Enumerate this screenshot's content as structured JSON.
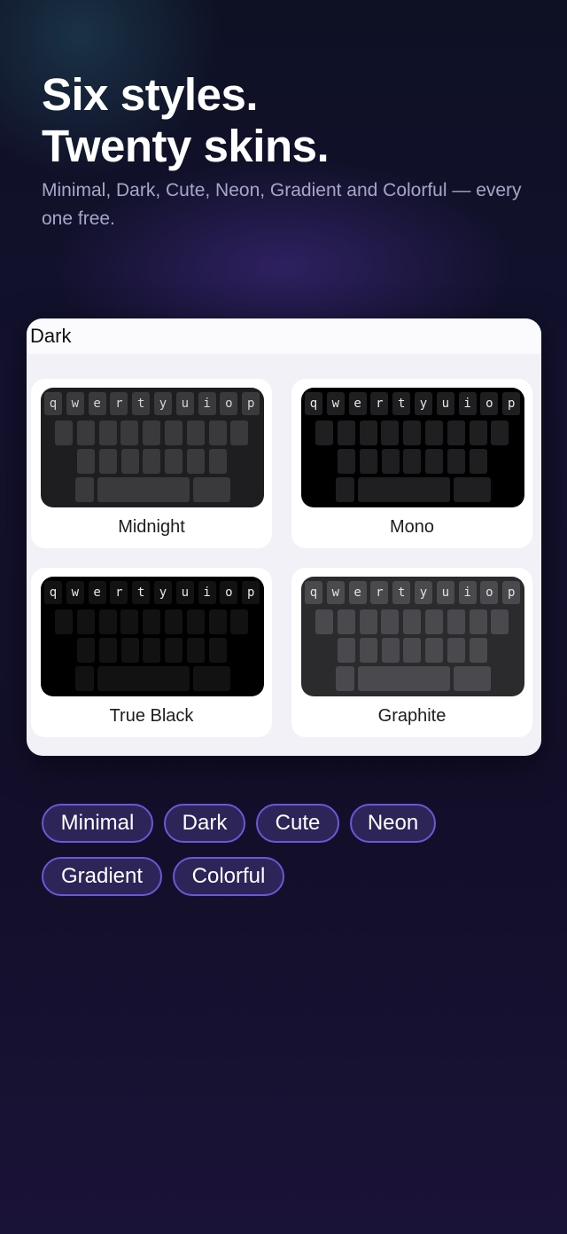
{
  "hero": {
    "title_line1": "Six styles.",
    "title_line2": "Twenty skins.",
    "subtitle": "Minimal, Dark, Cute, Neon, Gradient and Colorful — every one free."
  },
  "panel": {
    "header": "Dark",
    "skins": [
      {
        "name": "Midnight",
        "bg": "#1e1e20",
        "key": "#3a3a3d",
        "text": "#d6d6d8"
      },
      {
        "name": "Mono",
        "bg": "#000000",
        "key": "#1f1f21",
        "text": "#e8e8e8"
      },
      {
        "name": "True Black",
        "bg": "#000000",
        "key": "#121213",
        "text": "#e8e8e8"
      },
      {
        "name": "Graphite",
        "bg": "#2b2b2e",
        "key": "#4a4a4e",
        "text": "#e2e2e4"
      }
    ],
    "keyboard_letters": [
      "q",
      "w",
      "e",
      "r",
      "t",
      "y",
      "u",
      "i",
      "o",
      "p"
    ]
  },
  "categories": [
    "Minimal",
    "Dark",
    "Cute",
    "Neon",
    "Gradient",
    "Colorful"
  ],
  "colors": {
    "chip_border": "#6d56d8",
    "chip_fill": "#2d2558"
  }
}
